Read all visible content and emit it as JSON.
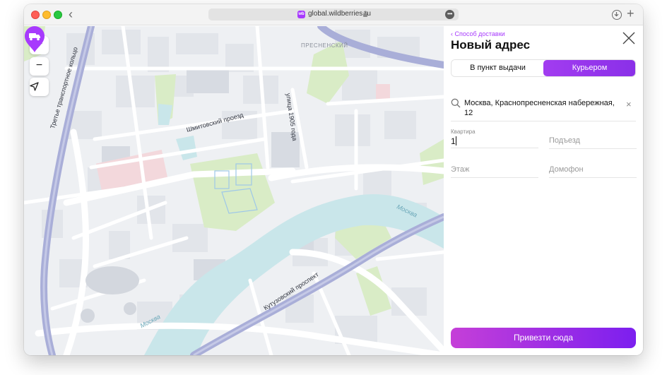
{
  "browser": {
    "url": "global.wildberries.ru",
    "favicon_text": "wb",
    "more_glyph": "•••",
    "back_glyph": "‹",
    "new_tab_glyph": "+"
  },
  "map": {
    "labels": {
      "ring_road": "Третье транспортное кольцо",
      "presnensky": "ПРЕСНЕНСКИЙ",
      "shmitovsky": "Шмитовский проезд",
      "street_1905": "улица 1905 года",
      "moskva_right": "Москва",
      "moskva_left": "Москва",
      "kutuzovsky": "Кутузовский проспект"
    },
    "controls": {
      "zoom_in": "+",
      "zoom_out": "−"
    }
  },
  "panel": {
    "back_link": "Способ доставки",
    "title": "Новый адрес",
    "tabs": [
      {
        "label": "В пункт выдачи",
        "active": false
      },
      {
        "label": "Курьером",
        "active": true
      }
    ],
    "address": "Москва, Краснопресненская набережная, 12",
    "clear_glyph": "×",
    "fields": {
      "apartment": {
        "label": "Квартира",
        "value": "1"
      },
      "entrance": {
        "placeholder": "Подъезд"
      },
      "floor": {
        "placeholder": "Этаж"
      },
      "intercom": {
        "placeholder": "Домофон"
      }
    },
    "submit_label": "Привезти сюда"
  },
  "colors": {
    "accent": "#a73afd",
    "water": "#c9e6ea",
    "park": "#d9ecc6",
    "highway": "#a9aed8"
  }
}
